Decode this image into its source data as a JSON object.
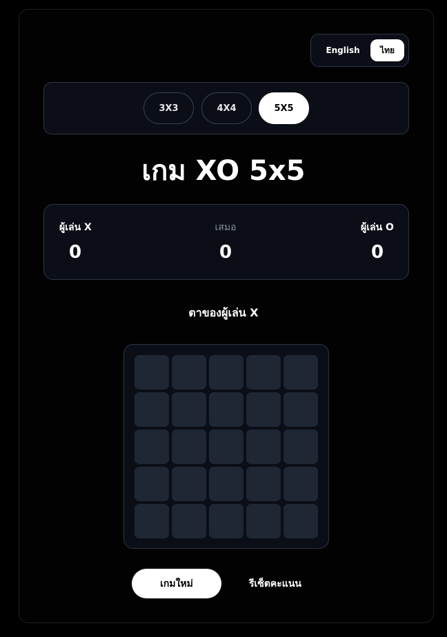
{
  "language": {
    "options": [
      "English",
      "ไทย"
    ],
    "selected": "ไทย"
  },
  "sizes": [
    {
      "label": "3X3",
      "active": false
    },
    {
      "label": "4X4",
      "active": false
    },
    {
      "label": "5X5",
      "active": true
    }
  ],
  "title": "เกม XO 5x5",
  "score": {
    "x_label": "ผู้เล่น X",
    "x": "0",
    "draw_label": "เสมอ",
    "draw": "0",
    "o_label": "ผู้เล่น O",
    "o": "0"
  },
  "status": "ตาของผู้เล่น X",
  "board": {
    "size": 5,
    "cells": [
      "",
      "",
      "",
      "",
      "",
      "",
      "",
      "",
      "",
      "",
      "",
      "",
      "",
      "",
      "",
      "",
      "",
      "",
      "",
      "",
      "",
      "",
      "",
      "",
      ""
    ]
  },
  "buttons": {
    "new_game": "เกมใหม่",
    "reset_score": "รีเซ็ตคะแนน"
  },
  "colors": {
    "active_bg": "#ffffff",
    "cell": "#1f2735",
    "panel": "#0b0e16"
  }
}
